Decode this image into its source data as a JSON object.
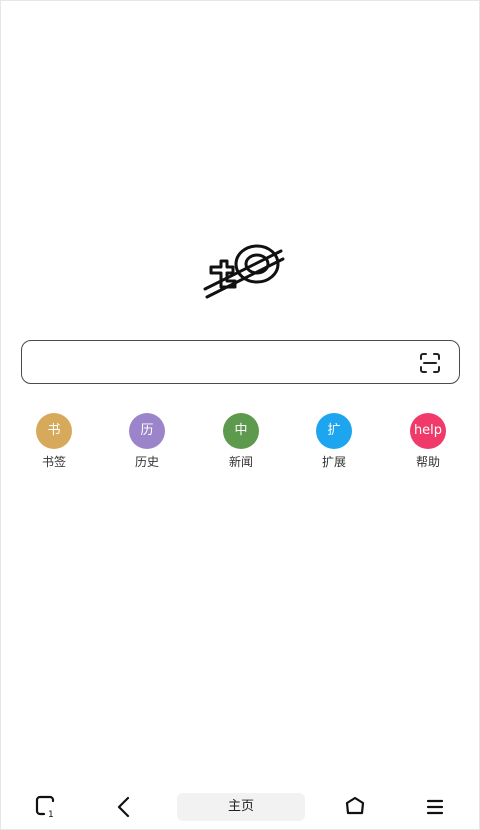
{
  "search": {
    "value": "",
    "placeholder": ""
  },
  "shortcuts": [
    {
      "glyph": "书",
      "label": "书签",
      "color": "#d7a95a",
      "icon": "bookmark"
    },
    {
      "glyph": "历",
      "label": "历史",
      "color": "#9b84c9",
      "icon": "history"
    },
    {
      "glyph": "中",
      "label": "新闻",
      "color": "#5d9a4e",
      "icon": "news"
    },
    {
      "glyph": "扩",
      "label": "扩展",
      "color": "#1ea5ef",
      "icon": "extensions"
    },
    {
      "glyph": "help",
      "label": "帮助",
      "color": "#ef3a6a",
      "icon": "help"
    }
  ],
  "bottom_bar": {
    "tabs_count": "1",
    "home_label": "主页",
    "icons": [
      "tabs-icon",
      "back-icon",
      "home-icon",
      "menu-icon"
    ]
  },
  "colors": {
    "border": "#4a4a4a",
    "pill_bg": "#f2f2f2"
  }
}
